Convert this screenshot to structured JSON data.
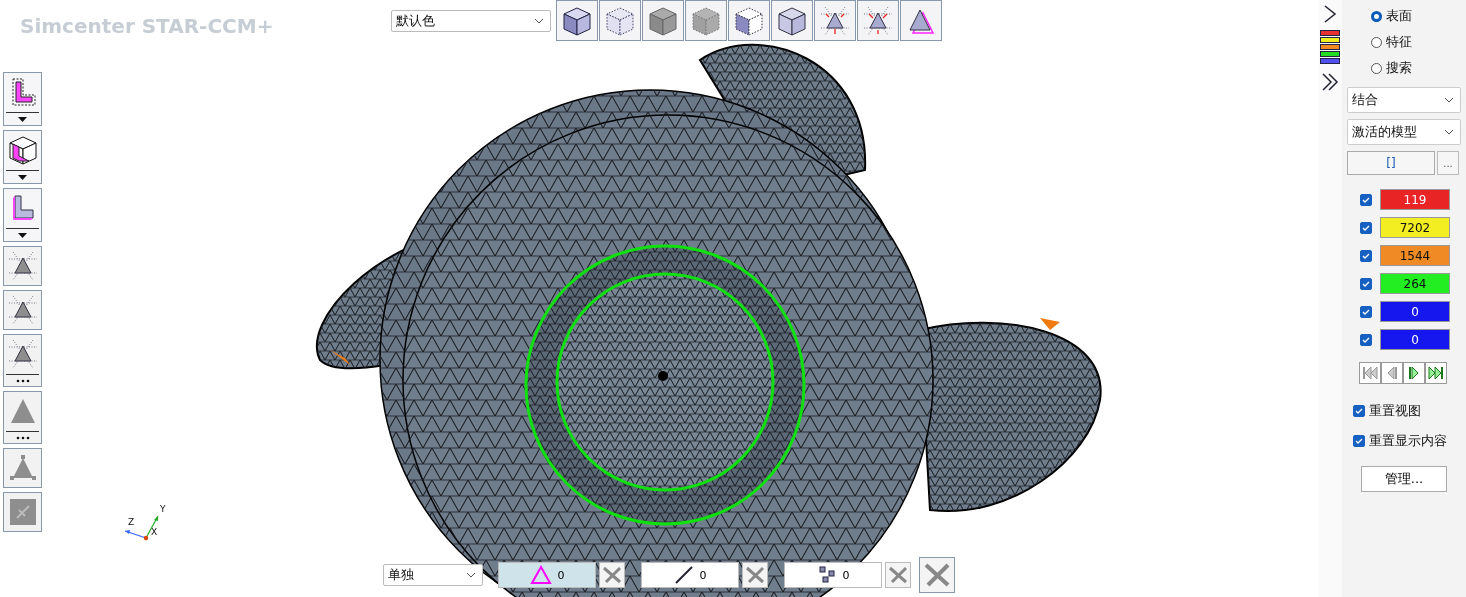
{
  "app_title": "Simcenter STAR-CCM+",
  "left_tools": [
    {
      "kind": "l-dashed",
      "dropdown_arrow": true,
      "more_dots": false,
      "disabled": false
    },
    {
      "kind": "cube-l",
      "dropdown_arrow": true,
      "more_dots": false,
      "disabled": false
    },
    {
      "kind": "l-solid",
      "dropdown_arrow": true,
      "more_dots": false,
      "disabled": false
    },
    {
      "kind": "tri-expand",
      "dropdown_arrow": false,
      "more_dots": false,
      "disabled": true
    },
    {
      "kind": "tri-contract",
      "dropdown_arrow": false,
      "more_dots": false,
      "disabled": true
    },
    {
      "kind": "tri-expand",
      "dropdown_arrow": false,
      "more_dots": true,
      "disabled": true
    },
    {
      "kind": "triangle",
      "dropdown_arrow": false,
      "more_dots": true,
      "disabled": true
    },
    {
      "kind": "tri-vertices",
      "dropdown_arrow": false,
      "more_dots": false,
      "disabled": true
    },
    {
      "kind": "swap",
      "dropdown_arrow": false,
      "more_dots": false,
      "disabled": true
    }
  ],
  "top_toolbar": {
    "color_dropdown": "默认色",
    "tools": [
      {
        "kind": "cube-solid"
      },
      {
        "kind": "cube-dotted"
      },
      {
        "kind": "cube-gray"
      },
      {
        "kind": "cube-gray-dotted"
      },
      {
        "kind": "cube-half"
      },
      {
        "kind": "cube-open"
      },
      {
        "kind": "tri-expand"
      },
      {
        "kind": "tri-contract"
      },
      {
        "kind": "tri-outline"
      }
    ]
  },
  "triad": {
    "axes": [
      "Z",
      "X",
      "Y"
    ]
  },
  "bottom_bar": {
    "mode_dropdown": "单独",
    "filters": [
      {
        "kind": "triangle",
        "count": "0",
        "selected": true
      },
      {
        "kind": "line",
        "count": "0",
        "selected": false
      },
      {
        "kind": "points",
        "count": "0",
        "selected": false
      }
    ]
  },
  "side_panel": {
    "radios": [
      {
        "label": "表面",
        "selected": true
      },
      {
        "label": "特征",
        "selected": false
      },
      {
        "label": "搜索",
        "selected": false
      }
    ],
    "dropdowns": [
      "结合",
      "激活的模型"
    ],
    "selection_field": "[]",
    "browse_button": "...",
    "counts": [
      {
        "value": "119",
        "color": "#e82424",
        "checked": true
      },
      {
        "value": "7202",
        "color": "#f2ee22",
        "checked": true
      },
      {
        "value": "1544",
        "color": "#f08a24",
        "checked": true
      },
      {
        "value": "264",
        "color": "#22ee22",
        "checked": true
      },
      {
        "value": "0",
        "color": "#1616ee",
        "checked": true
      },
      {
        "value": "0",
        "color": "#1616ee",
        "checked": true
      }
    ],
    "nav": [
      {
        "kind": "first",
        "disabled": true
      },
      {
        "kind": "prev",
        "disabled": true
      },
      {
        "kind": "next",
        "disabled": false
      },
      {
        "kind": "last",
        "disabled": false
      }
    ],
    "options": [
      {
        "label": "重置视图",
        "checked": true
      },
      {
        "label": "重置显示内容",
        "checked": true
      }
    ],
    "manage_button": "管理..."
  }
}
